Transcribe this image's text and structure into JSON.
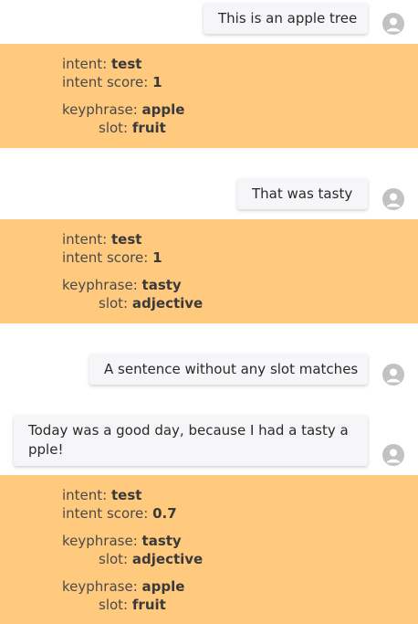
{
  "labels": {
    "intent": "intent:",
    "intent_score": "intent score:",
    "keyphrase": "keyphrase:",
    "slot": "slot:"
  },
  "messages": [
    {
      "text": "This is an apple tree"
    },
    {
      "text": "That was tasty"
    },
    {
      "text": "A sentence without any slot matches"
    },
    {
      "text": "Today was a good day, because I had a tasty apple!"
    }
  ],
  "results": [
    {
      "intent": "test",
      "intent_score": "1",
      "slots": [
        {
          "keyphrase": "apple",
          "slot": "fruit"
        }
      ]
    },
    {
      "intent": "test",
      "intent_score": "1",
      "slots": [
        {
          "keyphrase": "tasty",
          "slot": "adjective"
        }
      ]
    },
    {
      "intent": "test",
      "intent_score": "0.7",
      "slots": [
        {
          "keyphrase": "tasty",
          "slot": "adjective"
        },
        {
          "keyphrase": "apple",
          "slot": "fruit"
        }
      ]
    }
  ],
  "colors": {
    "panel": "#ffc97e",
    "bubble": "#f6f6f8",
    "avatar": "#c2c2c2"
  }
}
